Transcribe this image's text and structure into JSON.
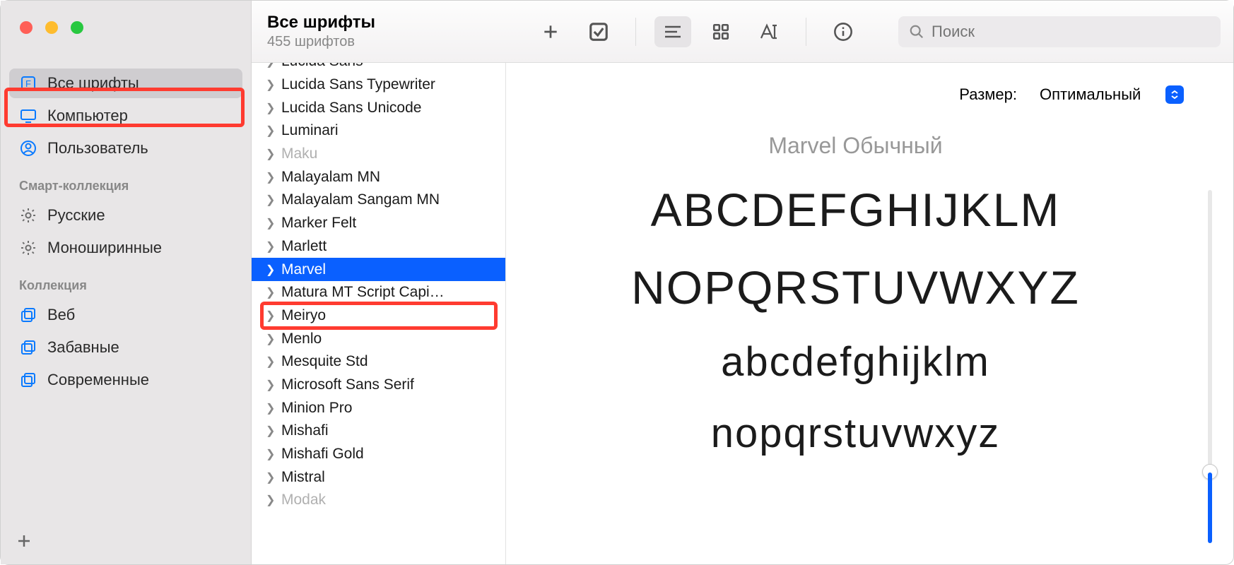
{
  "header": {
    "title": "Все шрифты",
    "subtitle": "455 шрифтов",
    "search_placeholder": "Поиск"
  },
  "sidebar": {
    "items_main": [
      {
        "label": "Все шрифты",
        "icon": "font-icon",
        "selected": true
      },
      {
        "label": "Компьютер",
        "icon": "display-icon",
        "selected": false
      },
      {
        "label": "Пользователь",
        "icon": "user-icon",
        "selected": false
      }
    ],
    "section_smart": "Смарт-коллекция",
    "items_smart": [
      {
        "label": "Русские",
        "icon": "gear-icon"
      },
      {
        "label": "Моноширинные",
        "icon": "gear-icon"
      }
    ],
    "section_coll": "Коллекция",
    "items_coll": [
      {
        "label": "Веб",
        "icon": "stack-icon"
      },
      {
        "label": "Забавные",
        "icon": "stack-icon"
      },
      {
        "label": "Современные",
        "icon": "stack-icon"
      }
    ]
  },
  "fonts": [
    {
      "name": "Lucida Sans",
      "partial_top": true
    },
    {
      "name": "Lucida Sans Typewriter"
    },
    {
      "name": "Lucida Sans Unicode"
    },
    {
      "name": "Luminari"
    },
    {
      "name": "Maku",
      "disabled": true
    },
    {
      "name": "Malayalam MN"
    },
    {
      "name": "Malayalam Sangam MN"
    },
    {
      "name": "Marker Felt"
    },
    {
      "name": "Marlett"
    },
    {
      "name": "Marvel",
      "selected": true
    },
    {
      "name": "Matura MT Script Capi…"
    },
    {
      "name": "Meiryo"
    },
    {
      "name": "Menlo"
    },
    {
      "name": "Mesquite Std"
    },
    {
      "name": "Microsoft Sans Serif"
    },
    {
      "name": "Minion Pro"
    },
    {
      "name": "Mishafi"
    },
    {
      "name": "Mishafi Gold"
    },
    {
      "name": "Mistral"
    },
    {
      "name": "Modak",
      "disabled": true
    }
  ],
  "preview": {
    "size_label": "Размер:",
    "size_value": "Оптимальный",
    "font_title": "Marvel Обычный",
    "line1": "ABCDEFGHIJKLM",
    "line2": "NOPQRSTUVWXYZ",
    "line3": "abcdefghijklm",
    "line4": "nopqrstuvwxyz"
  }
}
